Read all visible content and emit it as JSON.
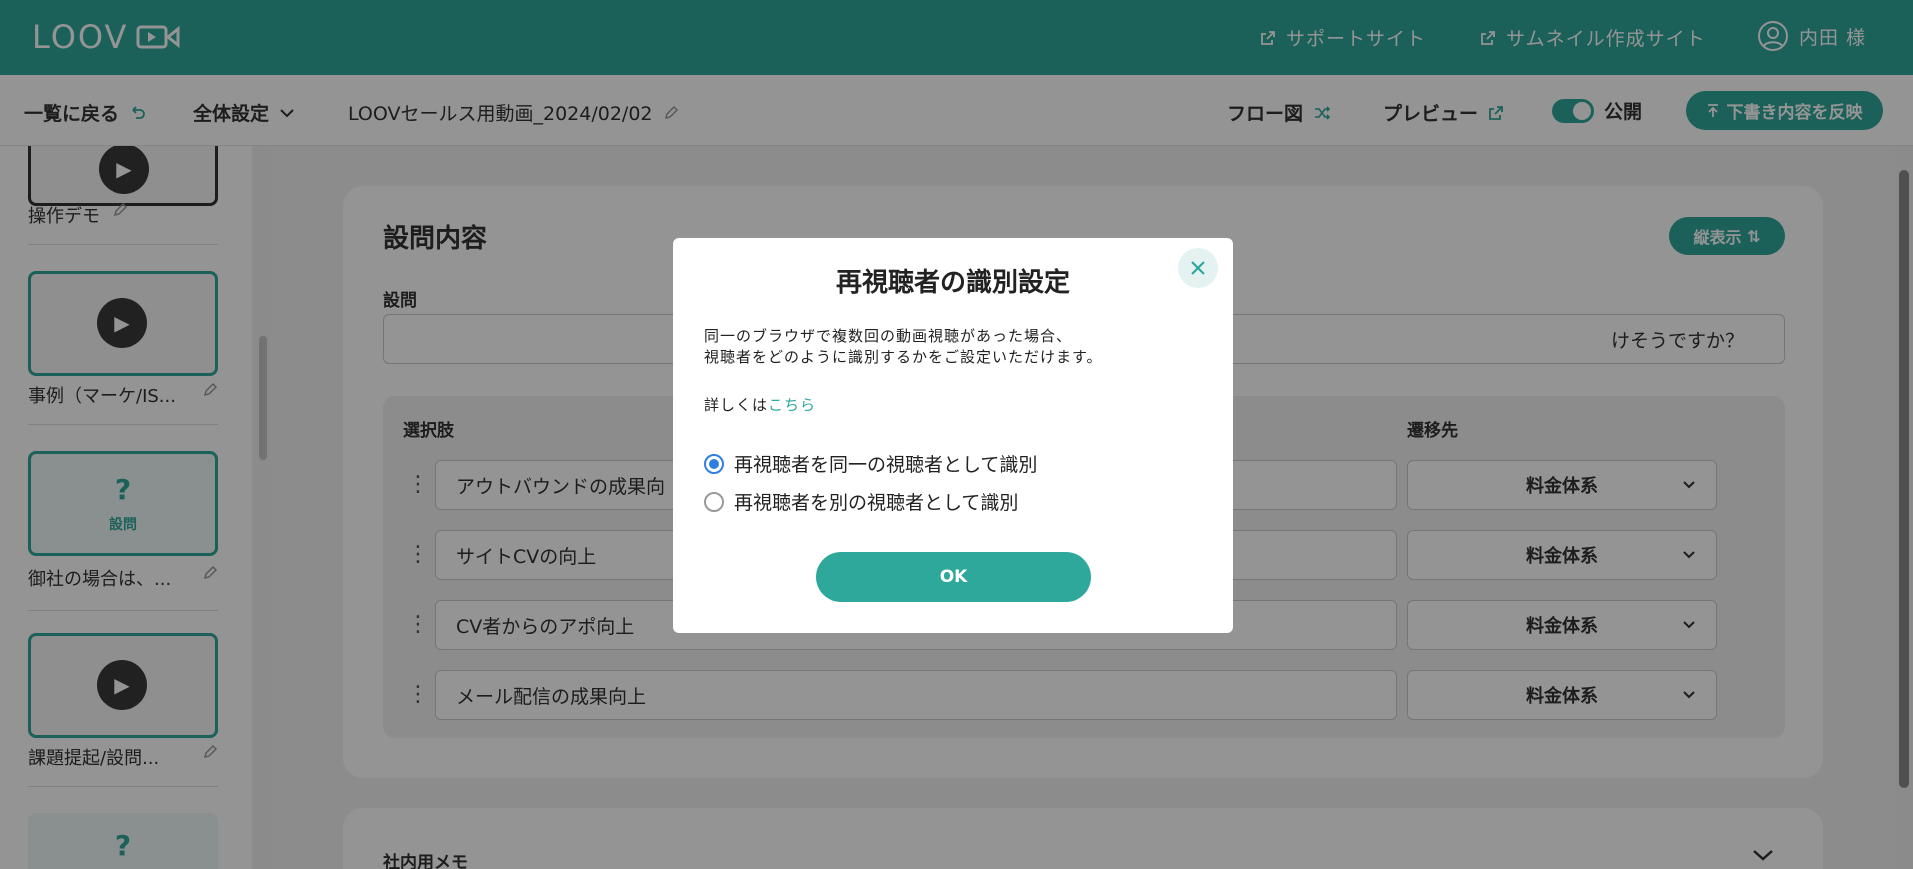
{
  "header": {
    "logo": "LOOV",
    "support_link": "サポートサイト",
    "thumbnail_link": "サムネイル作成サイト",
    "user": "内田 様"
  },
  "toolbar": {
    "back": "一覧に戻る",
    "settings": "全体設定",
    "title": "LOOVセールス用動画_2024/02/02",
    "flow": "フロー図",
    "preview": "プレビュー",
    "publish": "公開",
    "publish_on": true,
    "reflect": "下書き内容を反映"
  },
  "sidebar": {
    "items": [
      {
        "label": "操作デモ",
        "type": "video"
      },
      {
        "label": "事例（マーケ/IS...",
        "type": "video"
      },
      {
        "label": "御社の場合は、...",
        "type": "question",
        "badge": "設問"
      },
      {
        "label": "課題提起/設問...",
        "type": "video"
      },
      {
        "label": "",
        "type": "question"
      }
    ]
  },
  "main": {
    "heading": "設問内容",
    "vertical_button": "縦表示",
    "question_label": "設問",
    "question_value": "けそうですか？",
    "choices_header": "選択肢",
    "destination_header": "遷移先",
    "choices": [
      {
        "text": "アウトバウンドの成果向",
        "dest": "料金体系"
      },
      {
        "text": "サイトCVの向上",
        "dest": "料金体系"
      },
      {
        "text": "CV者からのアポ向上",
        "dest": "料金体系"
      },
      {
        "text": "メール配信の成果向上",
        "dest": "料金体系"
      }
    ],
    "memo": "社内用メモ"
  },
  "modal": {
    "title": "再視聴者の識別設定",
    "desc_line1": "同一のブラウザで複数回の動画視聴があった場合、",
    "desc_line2": "視聴者をどのように識別するかをご設定いただけます。",
    "more_prefix": "詳しくは",
    "more_link": "こちら",
    "options": [
      {
        "label": "再視聴者を同一の視聴者として識別",
        "selected": true
      },
      {
        "label": "再視聴者を別の視聴者として識別",
        "selected": false
      }
    ],
    "ok": "OK"
  },
  "colors": {
    "accent": "#2fa89c",
    "radio": "#2f7fe0"
  }
}
